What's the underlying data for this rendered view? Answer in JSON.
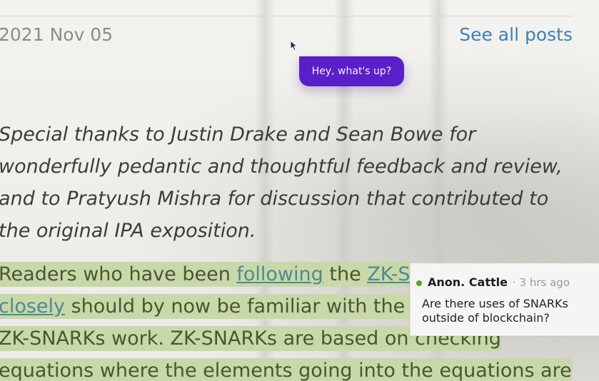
{
  "header": {
    "date": "2021 Nov 05",
    "see_all_link": "See all posts"
  },
  "chat_bubble": {
    "message": "Hey, what's up?"
  },
  "article": {
    "thanks_lines": [
      "Special thanks to Justin Drake and Sean Bowe for",
      "wonderfully pedantic and thoughtful feedback and review,",
      "and to Pratyush Mishra for discussion that contributed to",
      "the original IPA exposition."
    ],
    "para1": {
      "line1_a": "Readers who have been ",
      "line1_link1": "following",
      "line1_b": " the ",
      "line1_link2": "ZK-S",
      "line2_link": "closely",
      "line2_b": " should by now be familiar with the h",
      "line3": "ZK-SNARKs work. ZK-SNARKs are based on checking",
      "line4": "equations where the elements going into the equations are"
    }
  },
  "comment": {
    "author": "Anon. Cattle",
    "time": "· 3 hrs ago",
    "message": "Are there uses of SNARKs outside of blockchain?",
    "status_color": "#6a9d2c"
  },
  "colors": {
    "accent_link": "#3f7fb6",
    "bubble_bg": "#5a1fc9",
    "highlight": "#c8d8a8"
  }
}
